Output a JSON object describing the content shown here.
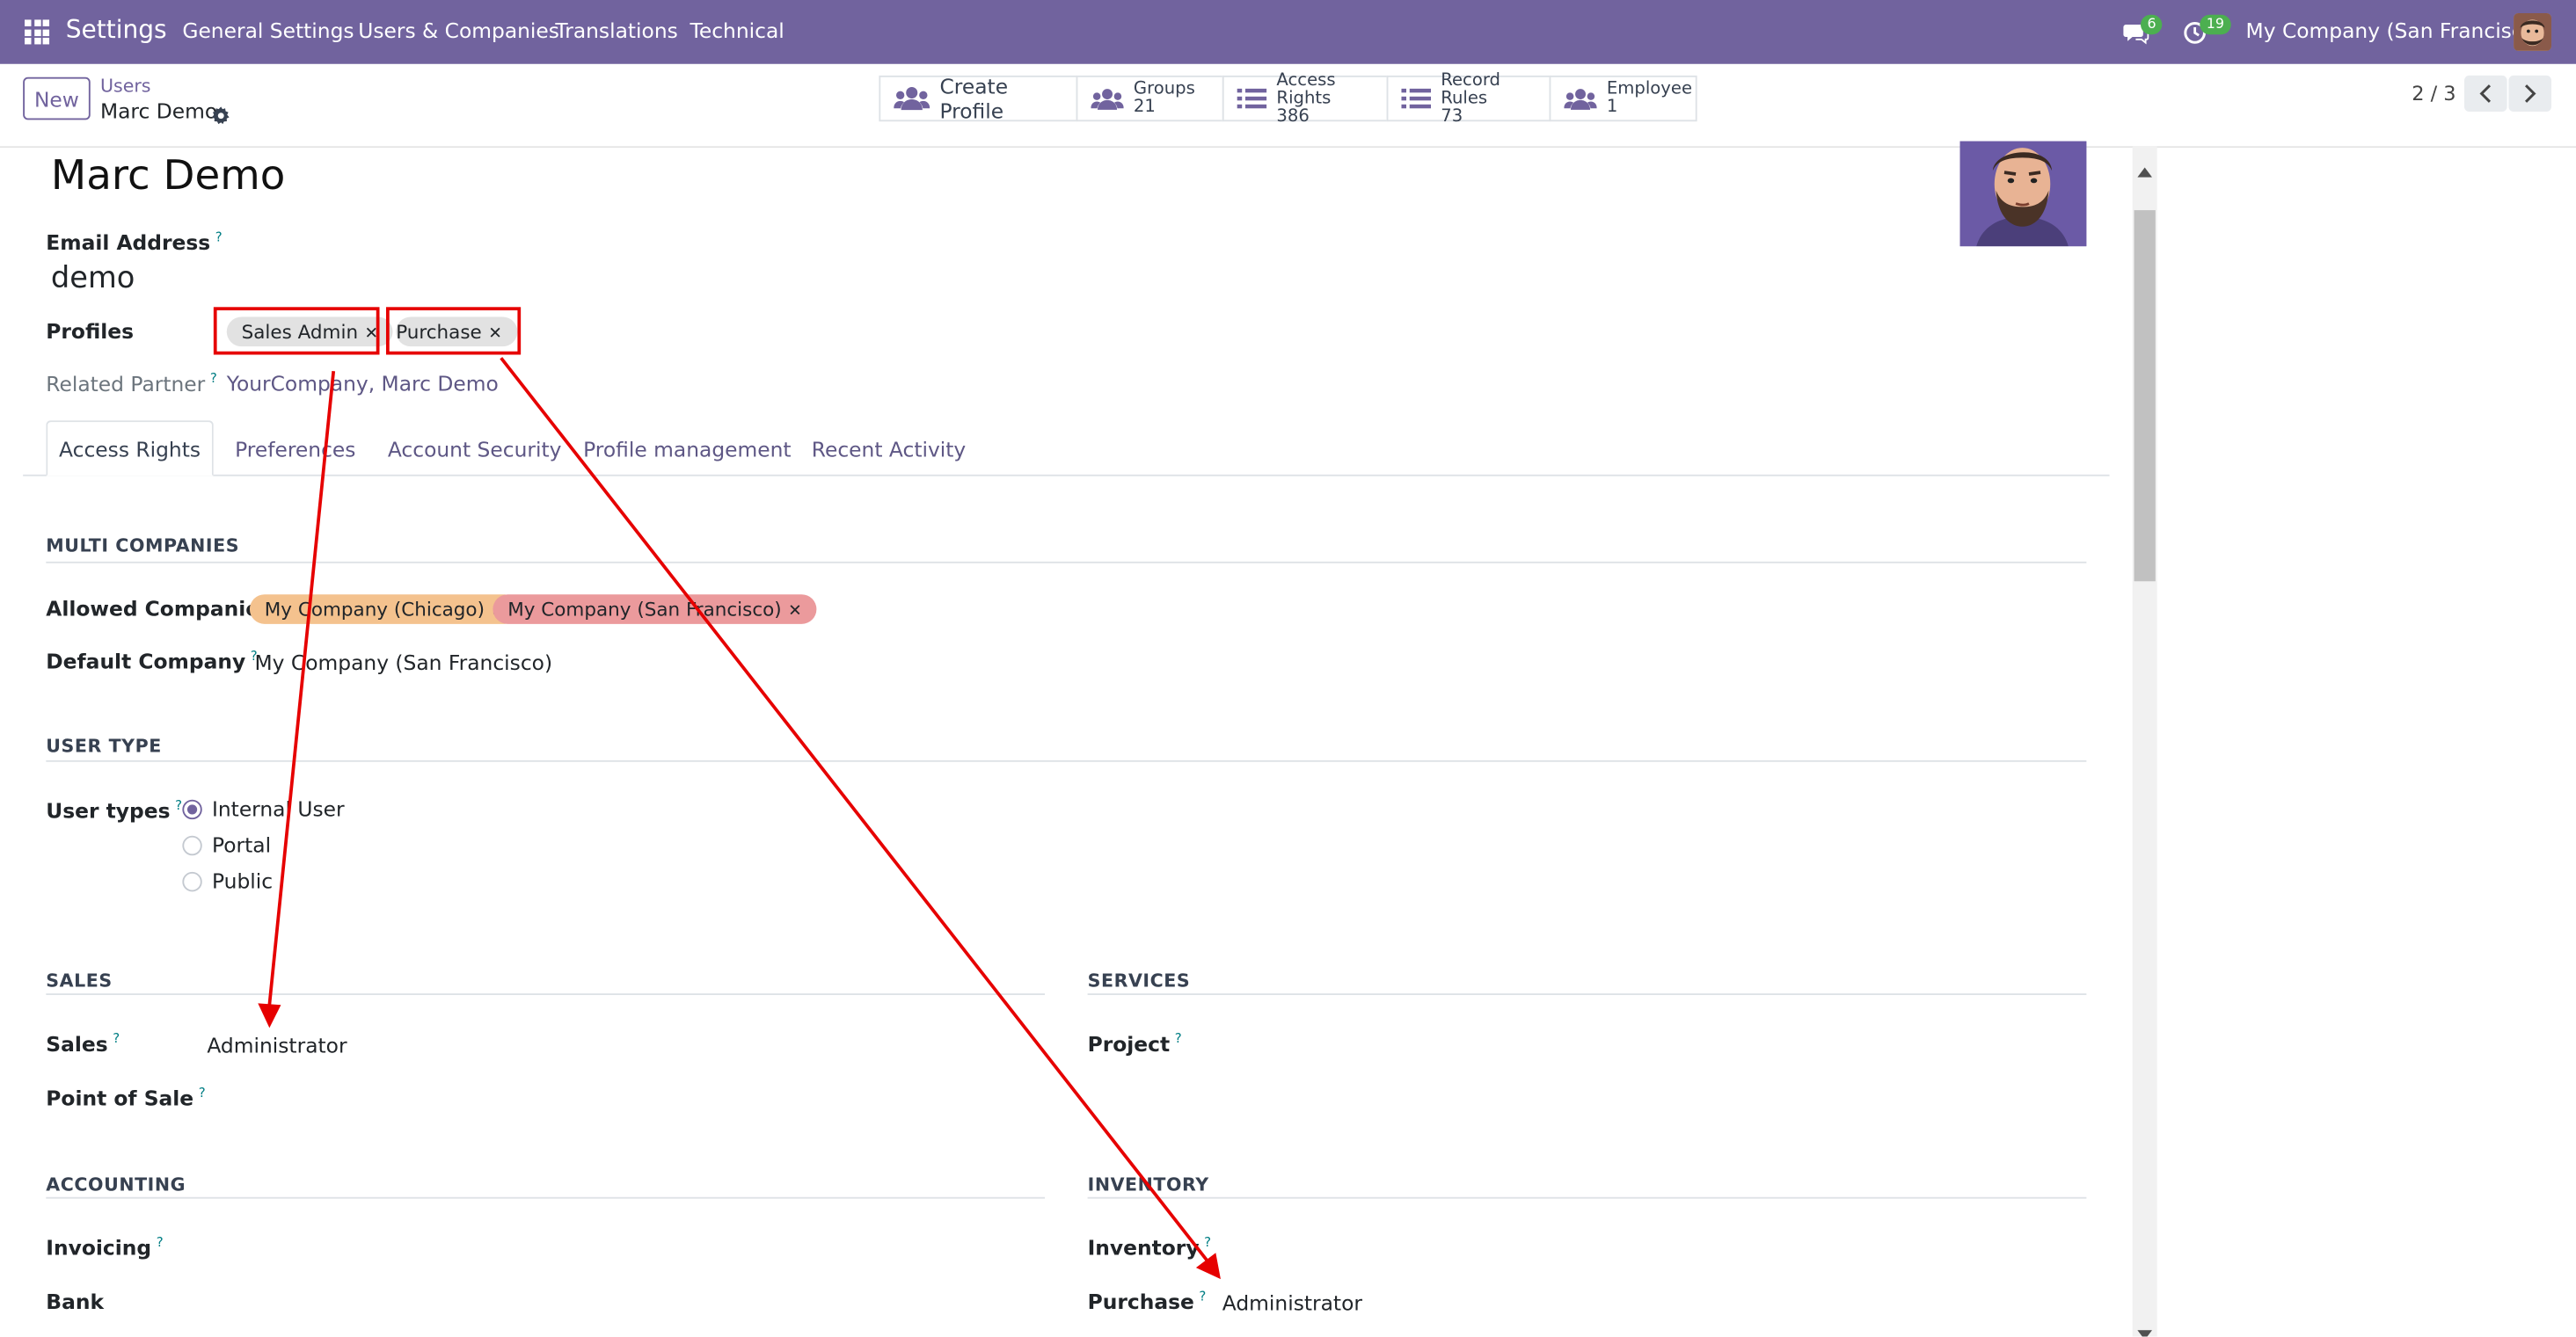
{
  "navbar": {
    "app_name": "Settings",
    "menu": [
      "General Settings",
      "Users & Companies",
      "Translations",
      "Technical"
    ],
    "messages_count": "6",
    "activities_count": "19",
    "company": "My Company (San Francisco)"
  },
  "control": {
    "new_label": "New",
    "breadcrumb_parent": "Users",
    "breadcrumb_current": "Marc Demo",
    "create_profile_label": "Create Profile",
    "smart_buttons": [
      {
        "label": "Groups",
        "count": "21",
        "icon": "users-icon"
      },
      {
        "label": "Access Rights",
        "count": "386",
        "icon": "list-icon"
      },
      {
        "label": "Record Rules",
        "count": "73",
        "icon": "list-icon"
      },
      {
        "label": "Employee",
        "count": "1",
        "icon": "users-icon"
      }
    ],
    "pager": "2 / 3"
  },
  "form": {
    "name": "Marc Demo",
    "email_label": "Email Address",
    "email_value": "demo",
    "profiles_label": "Profiles",
    "profiles": [
      "Sales Admin",
      "Purchase"
    ],
    "related_partner_label": "Related Partner",
    "related_partner_value": "YourCompany, Marc Demo"
  },
  "tabs": [
    "Access Rights",
    "Preferences",
    "Account Security",
    "Profile management",
    "Recent Activity"
  ],
  "access": {
    "multi_companies_title": "MULTI COMPANIES",
    "allowed_companies_label": "Allowed Companies",
    "allowed_companies": [
      "My Company (Chicago)",
      "My Company (San Francisco)"
    ],
    "default_company_label": "Default Company",
    "default_company_value": "My Company (San Francisco)",
    "user_type_title": "USER TYPE",
    "user_types_label": "User types",
    "user_type_options": [
      "Internal User",
      "Portal",
      "Public"
    ],
    "sales_title": "SALES",
    "sales_label": "Sales",
    "sales_value": "Administrator",
    "pos_label": "Point of Sale",
    "services_title": "SERVICES",
    "project_label": "Project",
    "accounting_title": "ACCOUNTING",
    "invoicing_label": "Invoicing",
    "bank_label": "Bank",
    "inventory_title": "INVENTORY",
    "inventory_label": "Inventory",
    "purchase_label": "Purchase",
    "purchase_value": "Administrator"
  },
  "colors": {
    "brand": "#71639e",
    "annotation_red": "#e60000",
    "tag_orange": "#f4c28e",
    "tag_red": "#eb9a9c"
  }
}
